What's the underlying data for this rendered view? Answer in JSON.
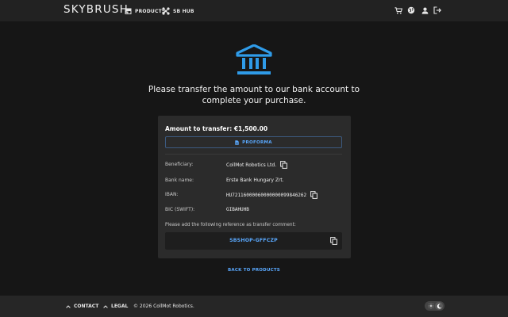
{
  "header": {
    "logo": "SKYBRUSH",
    "nav": [
      {
        "label": "PRODUCTS",
        "icon": "store-icon"
      },
      {
        "label": "SB HUB",
        "icon": "drone-icon"
      }
    ],
    "icons": [
      "cart-icon",
      "language-icon",
      "user-icon",
      "logout-icon"
    ]
  },
  "main": {
    "icon": "bank-icon",
    "headline": "Please transfer the amount to our bank account to complete your purchase.",
    "amount_label": "Amount to transfer:",
    "amount_value": "€1,500.00",
    "proforma_label": "PROFORMA",
    "details": [
      {
        "label": "Beneficiary:",
        "value": "CollMot Robotics Ltd.",
        "copyable": true
      },
      {
        "label": "Bank name:",
        "value": "Erste Bank Hungary Zrt.",
        "copyable": false
      },
      {
        "label": "IBAN:",
        "value": "HU72116000060000000099846262",
        "copyable": true
      },
      {
        "label": "BIC (SWIFT):",
        "value": "GIBAHUHB",
        "copyable": false
      }
    ],
    "reference_note": "Please add the following reference as transfer comment:",
    "reference_code": "SBSHOP-GFFCZP",
    "back_label": "BACK TO PRODUCTS"
  },
  "footer": {
    "contact": "CONTACT",
    "legal": "LEGAL",
    "copyright": "© 2026 CollMot Robotics.",
    "theme_toggle": "dark"
  },
  "colors": {
    "accent": "#2f9be8",
    "link": "#5aa9ff",
    "background": "#161616",
    "card": "#2b2b2b",
    "header": "#222222"
  }
}
